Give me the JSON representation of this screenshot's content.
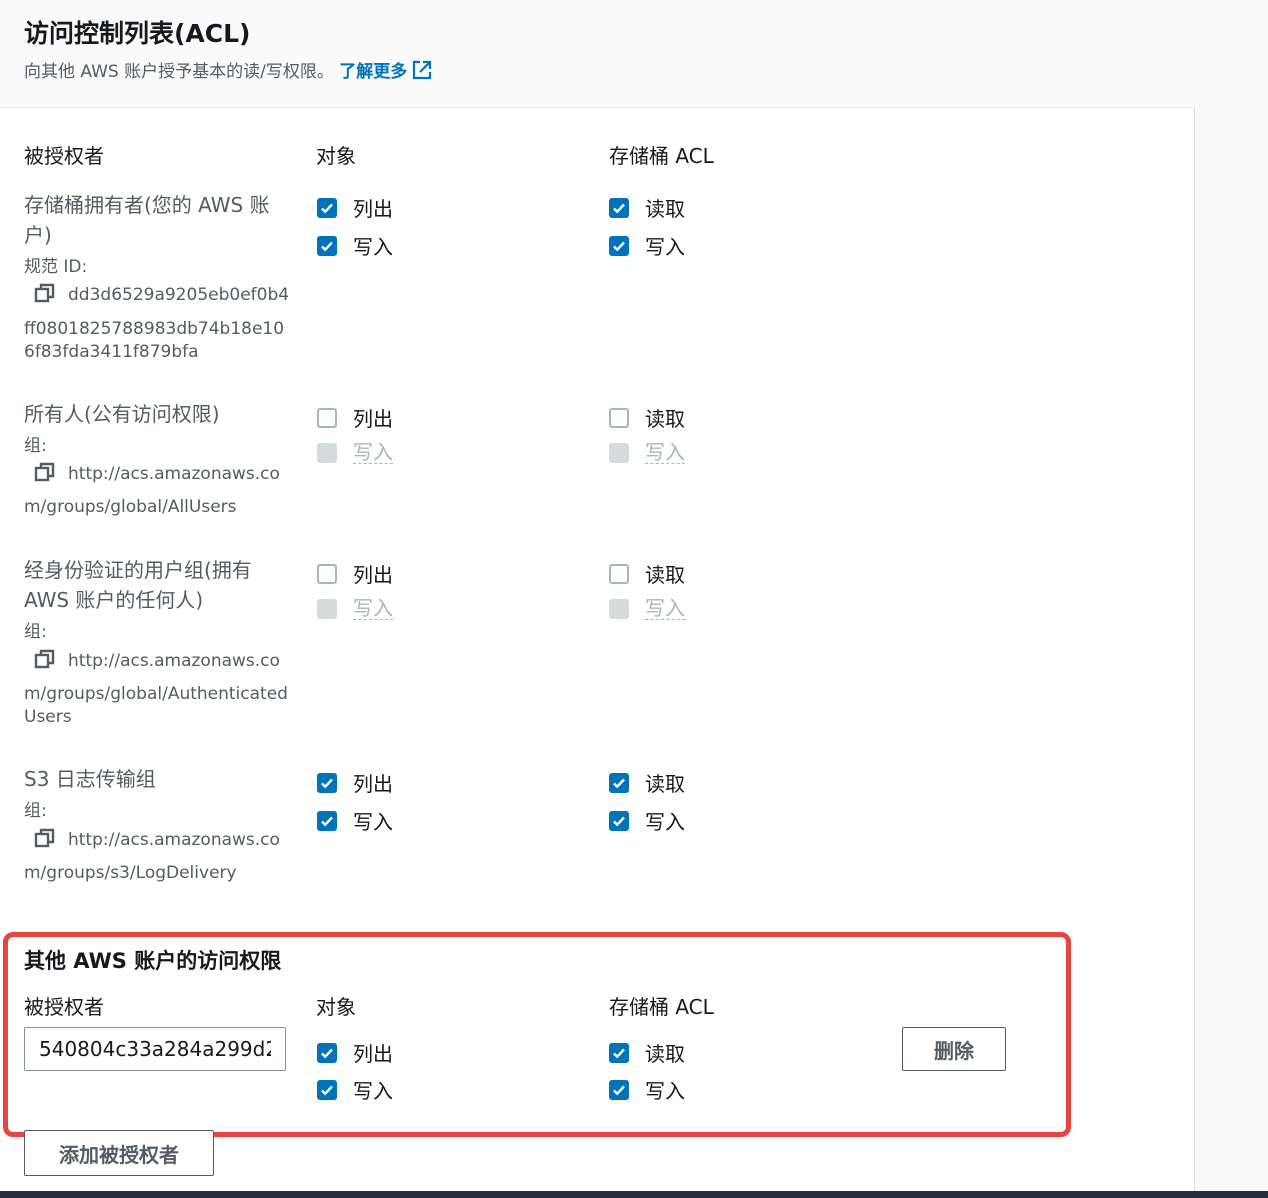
{
  "header": {
    "title": "访问控制列表(ACL)",
    "subtitle": "向其他 AWS 账户授予基本的读/写权限。",
    "learn_more": "了解更多"
  },
  "columns": {
    "grantee": "被授权者",
    "objects": "对象",
    "bucket_acl": "存储桶 ACL"
  },
  "grantees": [
    {
      "name": "存储桶拥有者(您的 AWS 账户)",
      "meta_label": "规范 ID:",
      "id_line1": "dd3d6529a9205eb0ef0b4",
      "id_rest": "ff0801825788983db74b18e106f83fda3411f879bfa",
      "objects": [
        {
          "label": "列出",
          "state": "checked"
        },
        {
          "label": "写入",
          "state": "checked"
        }
      ],
      "bucket": [
        {
          "label": "读取",
          "state": "checked"
        },
        {
          "label": "写入",
          "state": "checked"
        }
      ]
    },
    {
      "name": "所有人(公有访问权限)",
      "meta_label": "组:",
      "id_line1": "http://acs.amazonaws.co",
      "id_rest": "m/groups/global/AllUsers",
      "objects": [
        {
          "label": "列出",
          "state": "unchecked"
        },
        {
          "label": "写入",
          "state": "disabled"
        }
      ],
      "bucket": [
        {
          "label": "读取",
          "state": "unchecked"
        },
        {
          "label": "写入",
          "state": "disabled"
        }
      ]
    },
    {
      "name": "经身份验证的用户组(拥有 AWS 账户的任何人)",
      "meta_label": "组:",
      "id_line1": "http://acs.amazonaws.co",
      "id_rest": "m/groups/global/AuthenticatedUsers",
      "objects": [
        {
          "label": "列出",
          "state": "unchecked"
        },
        {
          "label": "写入",
          "state": "disabled"
        }
      ],
      "bucket": [
        {
          "label": "读取",
          "state": "unchecked"
        },
        {
          "label": "写入",
          "state": "disabled"
        }
      ]
    },
    {
      "name": "S3 日志传输组",
      "meta_label": "组:",
      "id_line1": "http://acs.amazonaws.co",
      "id_rest": "m/groups/s3/LogDelivery",
      "objects": [
        {
          "label": "列出",
          "state": "checked"
        },
        {
          "label": "写入",
          "state": "checked"
        }
      ],
      "bucket": [
        {
          "label": "读取",
          "state": "checked"
        },
        {
          "label": "写入",
          "state": "checked"
        }
      ]
    }
  ],
  "other_accounts": {
    "title": "其他 AWS 账户的访问权限",
    "grantee_value": "540804c33a284a299d2",
    "objects": [
      {
        "label": "列出",
        "state": "checked"
      },
      {
        "label": "写入",
        "state": "checked"
      }
    ],
    "bucket": [
      {
        "label": "读取",
        "state": "checked"
      },
      {
        "label": "写入",
        "state": "checked"
      }
    ],
    "remove_label": "删除"
  },
  "add_grantee_label": "添加被授权者",
  "colors": {
    "accent": "#0073bb",
    "highlight": "#e6463f"
  },
  "icons": {
    "external": "external-link-icon",
    "copy": "copy-icon",
    "check": "checkmark-icon"
  }
}
